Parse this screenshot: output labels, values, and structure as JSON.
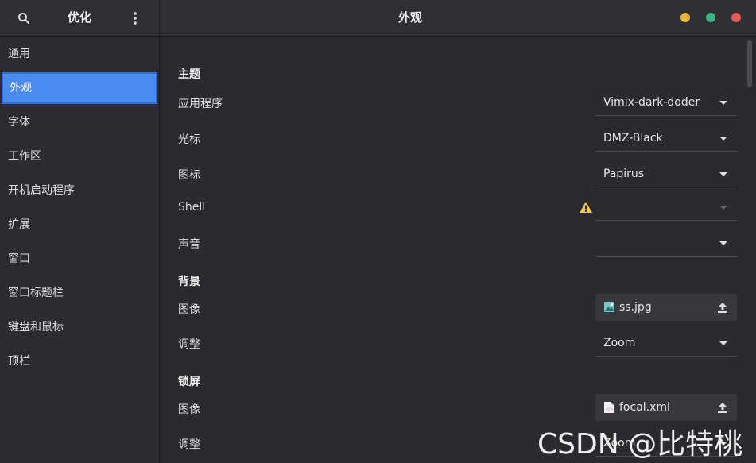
{
  "header": {
    "app_title": "优化",
    "page_title": "外观"
  },
  "sidebar": {
    "items": [
      {
        "label": "通用"
      },
      {
        "label": "外观"
      },
      {
        "label": "字体"
      },
      {
        "label": "工作区"
      },
      {
        "label": "开机启动程序"
      },
      {
        "label": "扩展"
      },
      {
        "label": "窗口"
      },
      {
        "label": "窗口标题栏"
      },
      {
        "label": "键盘和鼠标"
      },
      {
        "label": "顶栏"
      }
    ],
    "active_index": 1
  },
  "themes": {
    "title": "主题",
    "applications_label": "应用程序",
    "applications_value": "Vimix-dark-doder",
    "cursor_label": "光标",
    "cursor_value": "DMZ-Black",
    "icons_label": "图标",
    "icons_value": "Papirus",
    "shell_label": "Shell",
    "shell_value": "",
    "sound_label": "声音",
    "sound_value": ""
  },
  "background": {
    "title": "背景",
    "image_label": "图像",
    "image_file": "ss.jpg",
    "adjust_label": "调整",
    "adjust_value": "Zoom"
  },
  "lockscreen": {
    "title": "锁屏",
    "image_label": "图像",
    "image_file": "focal.xml",
    "adjust_label": "调整",
    "adjust_value": "Zoom"
  },
  "watermark": "CSDN @比特桃",
  "colors": {
    "accent": "#4a8bf0",
    "window_min": "#e3b83b",
    "window_max": "#3fb58a",
    "window_close": "#e55756",
    "warning": "#f2c94c"
  },
  "icons": [
    "search-icon",
    "menu-icon",
    "warning-icon",
    "image-file-icon",
    "xml-file-icon",
    "upload-icon"
  ]
}
